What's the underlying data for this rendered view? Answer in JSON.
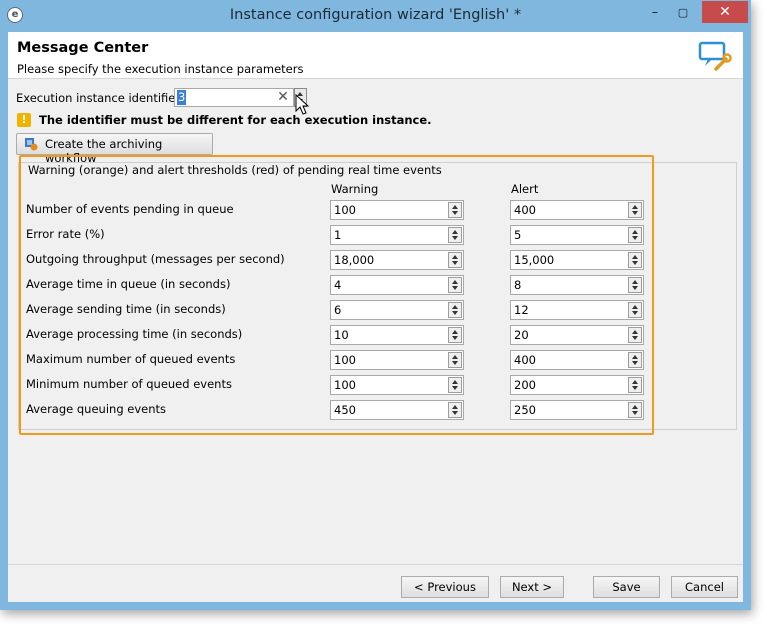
{
  "window": {
    "title": "Instance configuration wizard 'English' *",
    "min": "–",
    "max": "▢",
    "close": "✕"
  },
  "header": {
    "title": "Message Center",
    "subtitle": "Please specify the execution instance parameters"
  },
  "identifier": {
    "label": "Execution instance identifier:",
    "value": "3",
    "warning": "The identifier must be different for each execution instance."
  },
  "archive_button": {
    "label": "Create the archiving workflow"
  },
  "thresholds": {
    "title": "Warning (orange) and alert thresholds (red) of pending real time events",
    "col_warning": "Warning",
    "col_alert": "Alert",
    "rows": [
      {
        "label": "Number of events pending in queue",
        "warning": "100",
        "alert": "400"
      },
      {
        "label": "Error rate (%)",
        "warning": "1",
        "alert": "5"
      },
      {
        "label": "Outgoing throughput (messages per second)",
        "warning": "18,000",
        "alert": "15,000"
      },
      {
        "label": "Average time in queue (in seconds)",
        "warning": "4",
        "alert": "8"
      },
      {
        "label": "Average sending time (in seconds)",
        "warning": "6",
        "alert": "12"
      },
      {
        "label": "Average processing time (in seconds)",
        "warning": "10",
        "alert": "20"
      },
      {
        "label": "Maximum number of queued events",
        "warning": "100",
        "alert": "400"
      },
      {
        "label": "Minimum number of queued events",
        "warning": "100",
        "alert": "200"
      },
      {
        "label": "Average queuing events",
        "warning": "450",
        "alert": "250"
      }
    ]
  },
  "footer": {
    "previous": "< Previous",
    "next": "Next >",
    "save": "Save",
    "cancel": "Cancel"
  },
  "colors": {
    "titlebar": "#7fb7de",
    "highlight": "#f29a1c",
    "close": "#c74b4b"
  }
}
